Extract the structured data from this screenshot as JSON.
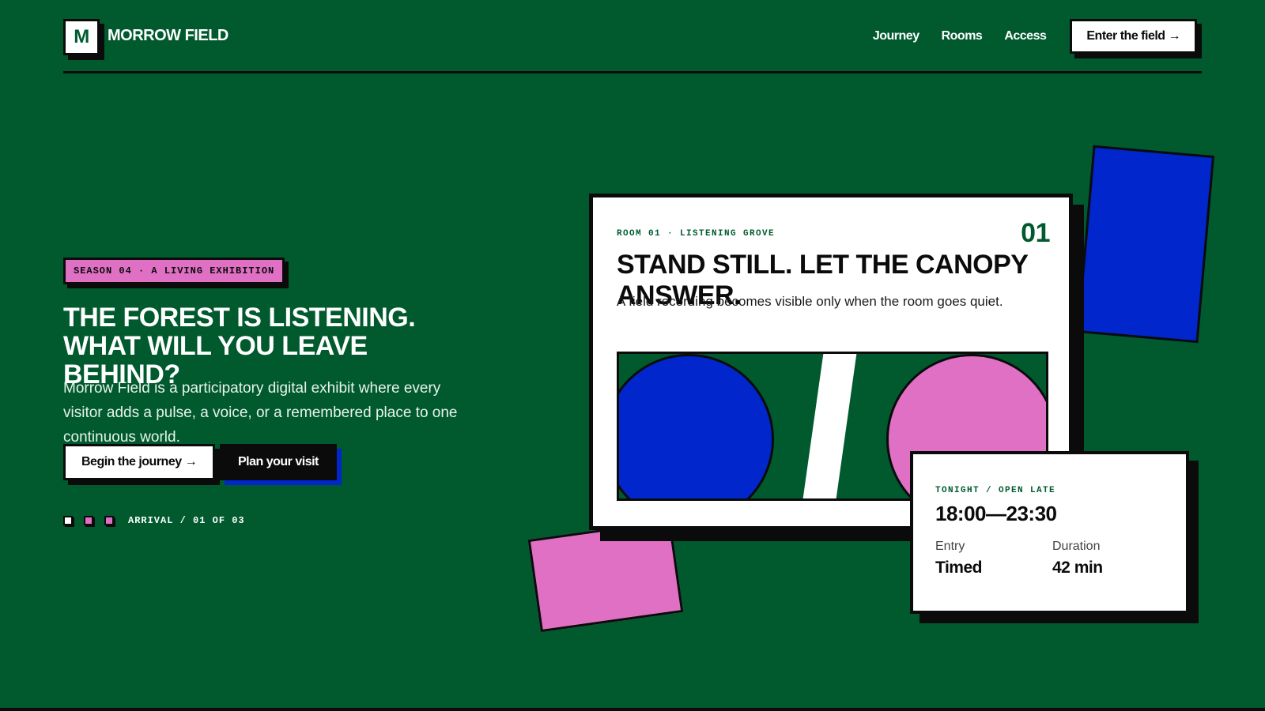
{
  "brand": {
    "logo_letter": "M",
    "name": "MORROW FIELD"
  },
  "nav": {
    "items": [
      "Journey",
      "Rooms",
      "Access"
    ],
    "cta": "Enter the field →"
  },
  "hero": {
    "badge": "SEASON 04 · A LIVING EXHIBITION",
    "headline": "The forest is listening. What will you leave behind?",
    "lead": "Morrow Field is a participatory digital exhibit where every visitor adds a pulse, a voice, or a remembered place to one continuous world.",
    "primary_button": "Begin the journey →",
    "secondary_button": "Plan your visit",
    "progress_label": "ARRIVAL / 01 OF 03"
  },
  "room_card": {
    "eyebrow": "ROOM 01 · LISTENING GROVE",
    "number": "01",
    "title": "Stand still. Let the canopy answer.",
    "subtitle": "A field recording becomes visible only when the room goes quiet."
  },
  "info_card": {
    "eyebrow": "TONIGHT / OPEN LATE",
    "time": "18:00—23:30",
    "entry_label": "Entry",
    "entry_value": "Timed",
    "duration_label": "Duration",
    "duration_value": "42 min"
  },
  "colors": {
    "background": "#005a2e",
    "pink": "#e070c4",
    "blue": "#0026cc",
    "ink": "#0b0b0b"
  }
}
